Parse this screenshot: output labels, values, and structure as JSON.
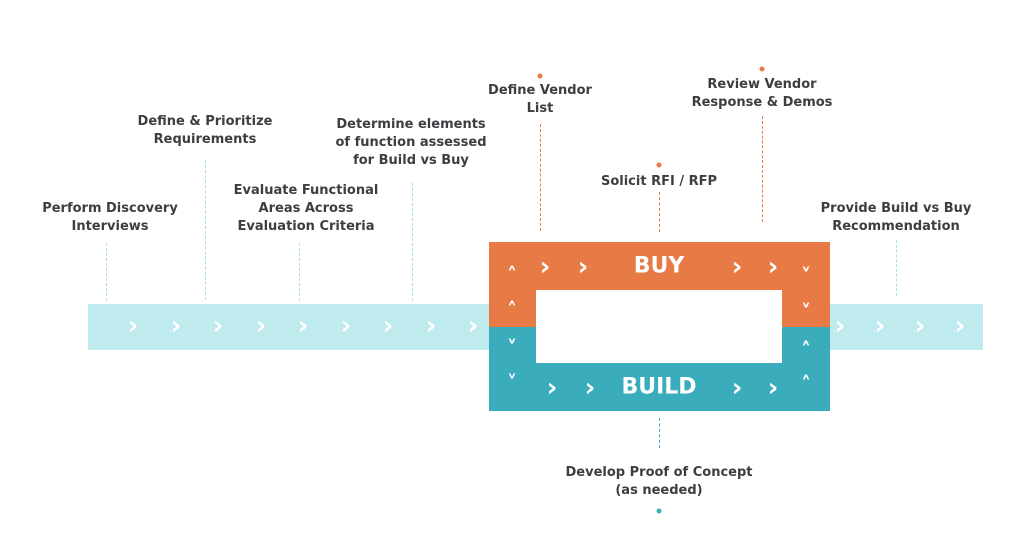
{
  "colors": {
    "track": "#bfeaee",
    "buy": "#e87a45",
    "build": "#3aacbb",
    "text": "#3d3d42"
  },
  "steps": [
    {
      "lines": [
        "Perform Discovery",
        "Interviews"
      ]
    },
    {
      "lines": [
        "Define & Prioritize",
        "Requirements"
      ]
    },
    {
      "lines": [
        "Evaluate Functional",
        "Areas Across",
        "Evaluation Criteria"
      ]
    },
    {
      "lines": [
        "Determine elements",
        "of function assessed",
        "for Build vs Buy"
      ]
    },
    {
      "lines": [
        "Define Vendor",
        "List"
      ]
    },
    {
      "lines": [
        "Solicit RFI / RFP"
      ]
    },
    {
      "lines": [
        "Review Vendor",
        "Response & Demos"
      ]
    },
    {
      "lines": [
        "Provide Build vs Buy",
        "Recommendation"
      ]
    },
    {
      "lines": [
        "Develop Proof of Concept",
        "(as needed)"
      ]
    }
  ],
  "loop": {
    "buy_label": "BUY",
    "build_label": "BUILD"
  },
  "icons": {
    "arrow": "chevron-right-icon",
    "up": "chevron-up-icon",
    "down": "chevron-down-icon"
  }
}
